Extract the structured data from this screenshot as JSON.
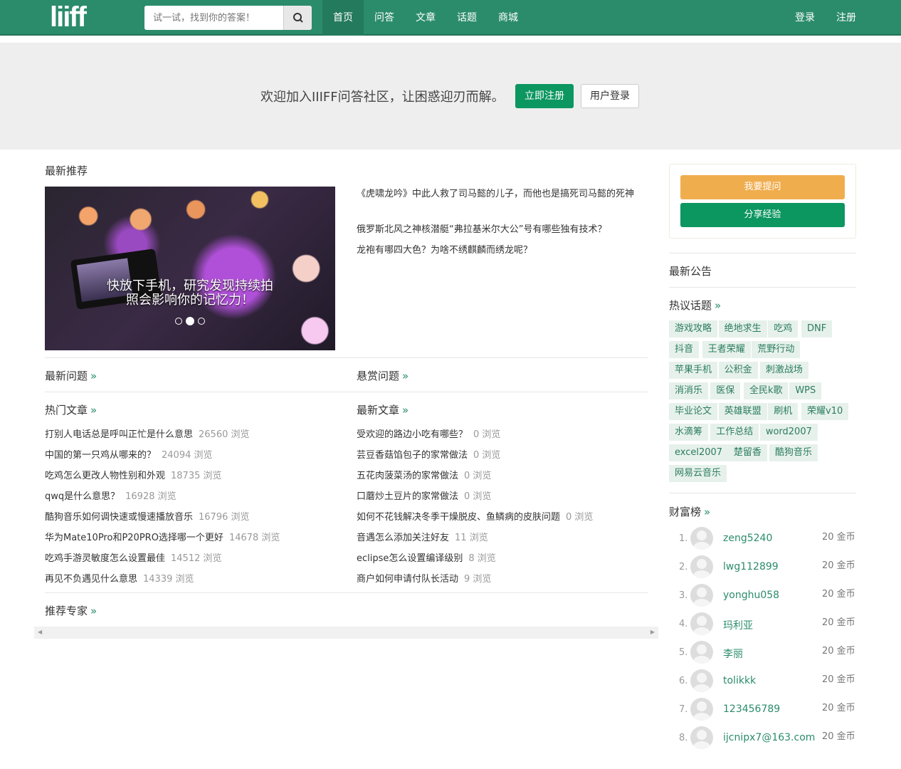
{
  "header": {
    "logo": "liiff",
    "search_placeholder": "试一试，找到你的答案！",
    "nav": [
      "首页",
      "问答",
      "文章",
      "话题",
      "商城"
    ],
    "login": "登录",
    "register": "注册"
  },
  "banner": {
    "welcome": "欢迎加入IIIFF问答社区，让困惑迎刃而解。",
    "register_btn": "立即注册",
    "login_btn": "用户登录"
  },
  "recommend": {
    "title": "最新推荐",
    "slide_caption_1": "快放下手机，研究发现持续拍",
    "slide_caption_2": "照会影响你的记忆力！",
    "slide_count": 3,
    "slide_active": 2,
    "links": [
      "《虎啸龙吟》中此人救了司马懿的儿子，而他也是搞死司马懿的死神",
      "俄罗斯北风之神核潜艇“弗拉基米尔大公”号有哪些独有技术？",
      "龙袍有哪四大色？为啥不绣麒麟而绣龙呢？"
    ]
  },
  "sections": {
    "latest_q": "最新问题",
    "bounty_q": "悬赏问题",
    "hot_articles": "热门文章",
    "latest_articles": "最新文章",
    "experts": "推荐专家",
    "more": "»"
  },
  "hot_articles": [
    {
      "t": "打别人电话总是呼叫正忙是什么意思",
      "c": "26560 浏览"
    },
    {
      "t": "中国的第一只鸡从哪来的？",
      "c": "24094 浏览"
    },
    {
      "t": "吃鸡怎么更改人物性别和外观",
      "c": "18735 浏览"
    },
    {
      "t": "qwq是什么意思？",
      "c": "16928 浏览"
    },
    {
      "t": "酷狗音乐如何调快速或慢速播放音乐",
      "c": "16796 浏览"
    },
    {
      "t": "华为Mate10Pro和P20PRO选择哪一个更好",
      "c": "14678 浏览"
    },
    {
      "t": "吃鸡手游灵敏度怎么设置最佳",
      "c": "14512 浏览"
    },
    {
      "t": "再见不负遇见什么意思",
      "c": "14339 浏览"
    }
  ],
  "latest_articles": [
    {
      "t": "受欢迎的路边小吃有哪些？",
      "c": "0 浏览"
    },
    {
      "t": "芸豆香菇馅包子的家常做法",
      "c": "0 浏览"
    },
    {
      "t": "五花肉菠菜汤的家常做法",
      "c": "0 浏览"
    },
    {
      "t": "口蘑炒土豆片的家常做法",
      "c": "0 浏览"
    },
    {
      "t": "如何不花钱解决冬季干燥脱皮、鱼鳞病的皮肤问题",
      "c": "0 浏览"
    },
    {
      "t": "音遇怎么添加关注好友",
      "c": "11 浏览"
    },
    {
      "t": "eclipse怎么设置编译级别",
      "c": "8 浏览"
    },
    {
      "t": "商户如何申请付队长活动",
      "c": "9 浏览"
    }
  ],
  "sidebar": {
    "ask": "我要提问",
    "share": "分享经验",
    "notice": "最新公告",
    "hot_topics": "热议话题",
    "wealth": "财富榜",
    "tags": [
      [
        "游戏攻略",
        "绝地求生",
        "吃鸡",
        "DNF"
      ],
      [
        "抖音",
        "王者荣耀",
        "荒野行动"
      ],
      [
        "苹果手机",
        "公积金",
        "刺激战场"
      ],
      [
        "消消乐",
        "医保",
        "全民k歌",
        "WPS"
      ],
      [
        "毕业论文",
        "英雄联盟",
        "刷机",
        "荣耀v10"
      ],
      [
        "水滴筹",
        "工作总结",
        "word2007"
      ],
      [
        "excel2007",
        "楚留香",
        "酷狗音乐"
      ],
      [
        "网易云音乐"
      ]
    ],
    "ranking": [
      {
        "r": "1.",
        "n": "zeng5240",
        "c": "20 金币"
      },
      {
        "r": "2.",
        "n": "lwg112899",
        "c": "20 金币"
      },
      {
        "r": "3.",
        "n": "yonghu058",
        "c": "20 金币"
      },
      {
        "r": "4.",
        "n": "玛利亚",
        "c": "20 金币"
      },
      {
        "r": "5.",
        "n": "李丽",
        "c": "20 金币"
      },
      {
        "r": "6.",
        "n": "tolikkk",
        "c": "20 金币"
      },
      {
        "r": "7.",
        "n": "123456789",
        "c": "20 金币"
      },
      {
        "r": "8.",
        "n": "ijcnipx7@163.com",
        "c": "20 金币"
      }
    ]
  },
  "colors": {
    "brand": "#2b8c6b",
    "orange": "#f0ad4e",
    "green": "#0c9660"
  }
}
